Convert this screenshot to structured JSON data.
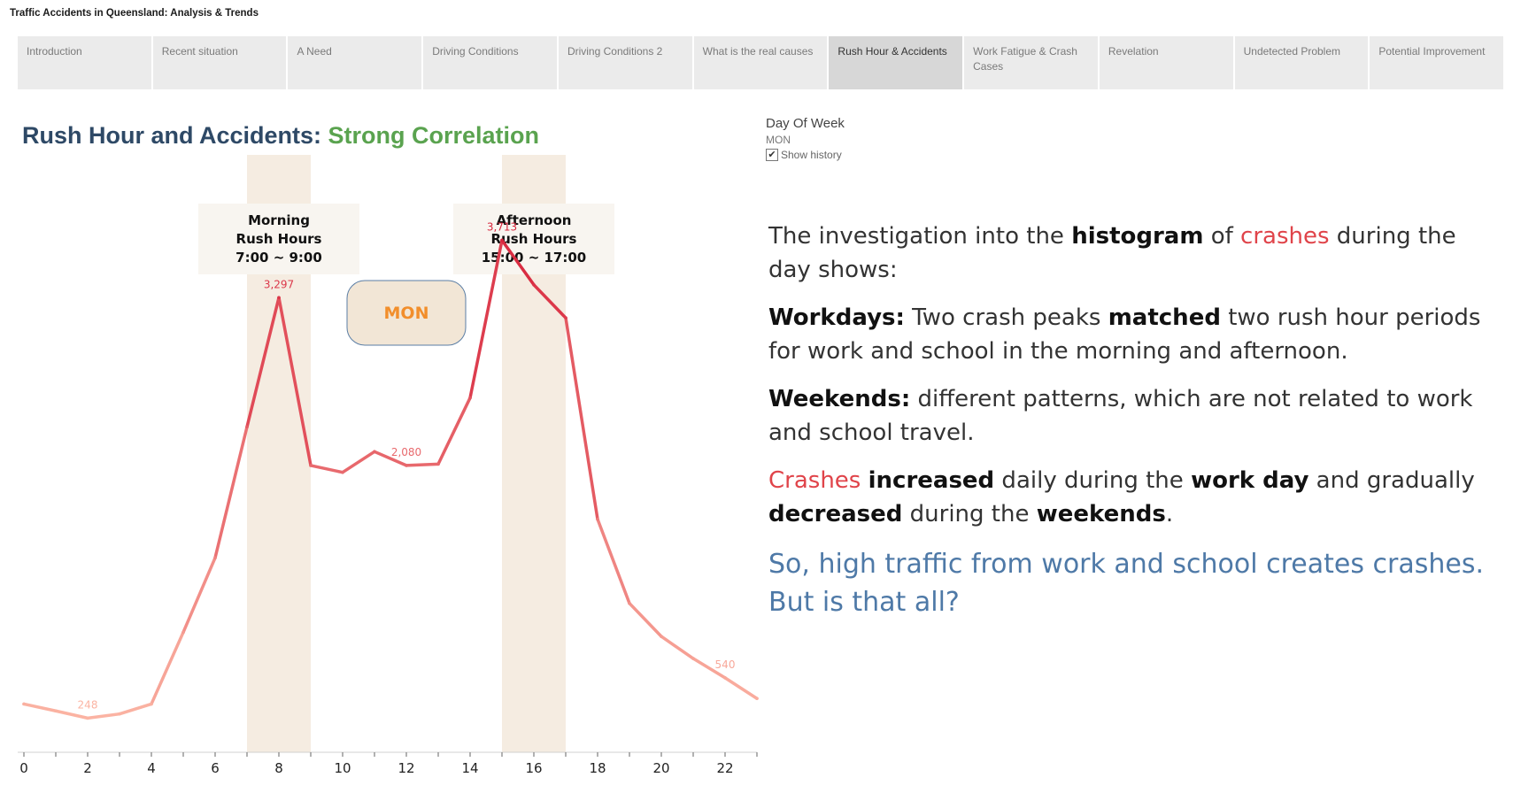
{
  "app_title": "Traffic Accidents in Queensland: Analysis & Trends",
  "tabs": [
    {
      "label": "Introduction",
      "active": false
    },
    {
      "label": "Recent situation",
      "active": false
    },
    {
      "label": "A Need",
      "active": false
    },
    {
      "label": "Driving Conditions",
      "active": false
    },
    {
      "label": "Driving Conditions 2",
      "active": false
    },
    {
      "label": "What is the real causes",
      "active": false
    },
    {
      "label": "Rush Hour & Accidents",
      "active": true
    },
    {
      "label": "Work Fatigue & Crash Cases",
      "active": false
    },
    {
      "label": "Revelation",
      "active": false
    },
    {
      "label": "Undetected Problem",
      "active": false
    },
    {
      "label": "Potential Improvement",
      "active": false
    }
  ],
  "heading": {
    "main": "Rush Hour and Accidents: ",
    "accent": "Strong Correlation",
    "main_color": "#2e4966",
    "accent_color": "#5aa34f"
  },
  "filter": {
    "label": "Day Of Week",
    "value": "MON",
    "show_history_label": "Show history",
    "show_history_checked": true
  },
  "story": {
    "p1": [
      {
        "t": "The investigation into the ",
        "s": ""
      },
      {
        "t": "histogram",
        "s": "b"
      },
      {
        "t": " of ",
        "s": ""
      },
      {
        "t": "crashes",
        "s": "red"
      },
      {
        "t": " during the day shows:",
        "s": ""
      }
    ],
    "p2": [
      {
        "t": "Workdays:",
        "s": "b"
      },
      {
        "t": " Two crash peaks ",
        "s": ""
      },
      {
        "t": "matched",
        "s": "b"
      },
      {
        "t": " two rush hour periods for work and school in the morning and afternoon.",
        "s": ""
      }
    ],
    "p3": [
      {
        "t": "Weekends:",
        "s": "b"
      },
      {
        "t": " different patterns, which are not related to work and school travel.",
        "s": ""
      }
    ],
    "p4": [
      {
        "t": "Crashes",
        "s": "red"
      },
      {
        "t": " ",
        "s": ""
      },
      {
        "t": "increased",
        "s": "b"
      },
      {
        "t": " daily during the ",
        "s": ""
      },
      {
        "t": "work day",
        "s": "b"
      },
      {
        "t": " and gradually ",
        "s": ""
      },
      {
        "t": "decreased",
        "s": "b"
      },
      {
        "t": " during the ",
        "s": ""
      },
      {
        "t": "weekends",
        "s": "b"
      },
      {
        "t": ".",
        "s": ""
      }
    ],
    "conclusion": "So, high traffic from work and school creates crashes. But is that all?"
  },
  "chart_data": {
    "type": "line",
    "x": [
      0,
      1,
      2,
      3,
      4,
      5,
      6,
      7,
      8,
      9,
      10,
      11,
      12,
      13,
      14,
      15,
      16,
      17,
      18,
      19,
      20,
      21,
      22,
      23
    ],
    "series": [
      {
        "values": [
          350,
          300,
          248,
          278,
          350,
          870,
          1410,
          2360,
          3297,
          2080,
          2030,
          2180,
          2080,
          2090,
          2570,
          3713,
          3390,
          3150,
          1690,
          1080,
          840,
          680,
          540,
          390
        ],
        "color_low": "#fbb4a3",
        "color_high": "#d7263d"
      }
    ],
    "data_labels": [
      {
        "x": 2,
        "text": "248"
      },
      {
        "x": 8,
        "text": "3,297"
      },
      {
        "x": 12,
        "text": "2,080"
      },
      {
        "x": 15,
        "text": "3,713"
      },
      {
        "x": 22,
        "text": "540"
      }
    ],
    "x_ticks": [
      "0",
      "2",
      "4",
      "6",
      "8",
      "10",
      "12",
      "14",
      "16",
      "18",
      "20",
      "22"
    ],
    "xlim": [
      0,
      23
    ],
    "ylim": [
      0,
      4300
    ],
    "grid": false,
    "highlight_bands": [
      {
        "x_from": 7,
        "x_to": 9,
        "title_lines": [
          "Morning",
          "Rush Hours",
          "7:00 ~ 9:00"
        ]
      },
      {
        "x_from": 15,
        "x_to": 17,
        "title_lines": [
          "Afternoon",
          "Rush Hours",
          "15:00 ~ 17:00"
        ]
      }
    ],
    "band_color": "#f5ece1",
    "annotation_color": "#f8f5f0",
    "day_label": "MON",
    "day_label_color": "#f28e2b",
    "day_label_bg": "#f2e6d6",
    "day_label_border": "#5b7ea5"
  }
}
